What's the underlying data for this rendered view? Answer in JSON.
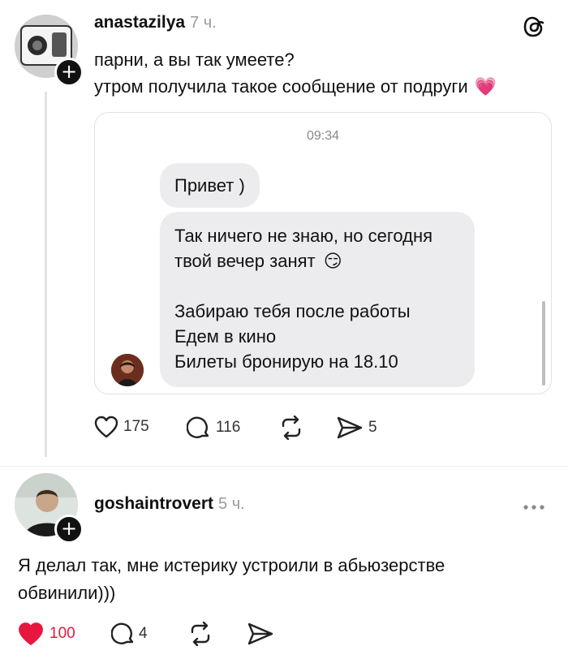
{
  "post": {
    "username": "anastazilya",
    "time": "7 ч.",
    "text_line1": "парни, а вы так умеете?",
    "text_line2": "утром получила такое сообщение от подруги",
    "emoji": "💗",
    "screenshot": {
      "time": "09:34",
      "bubble1": "Привет )",
      "bubble2_line1": "Так ничего не знаю, но сегодня",
      "bubble2_line2": "твой вечер занят",
      "bubble2_emoji": "😏",
      "bubble2_line3": "Забираю тебя после работы",
      "bubble2_line4": "Едем в кино",
      "bubble2_line5": "Билеты бронирую на 18.10"
    },
    "likes": "175",
    "comments": "116",
    "shares": "5"
  },
  "reply": {
    "username": "goshaintrovert",
    "time": "5 ч.",
    "text_line1": "Я делал так, мне истерику устроили в абьюзерстве",
    "text_line2": "обвинили)))",
    "likes": "100",
    "comments": "4",
    "like_color": "#e8173f"
  },
  "icons": {
    "threads": "threads-logo-icon",
    "like": "heart-icon",
    "comment": "comment-icon",
    "repost": "repost-icon",
    "share": "share-icon",
    "more": "more-icon"
  }
}
